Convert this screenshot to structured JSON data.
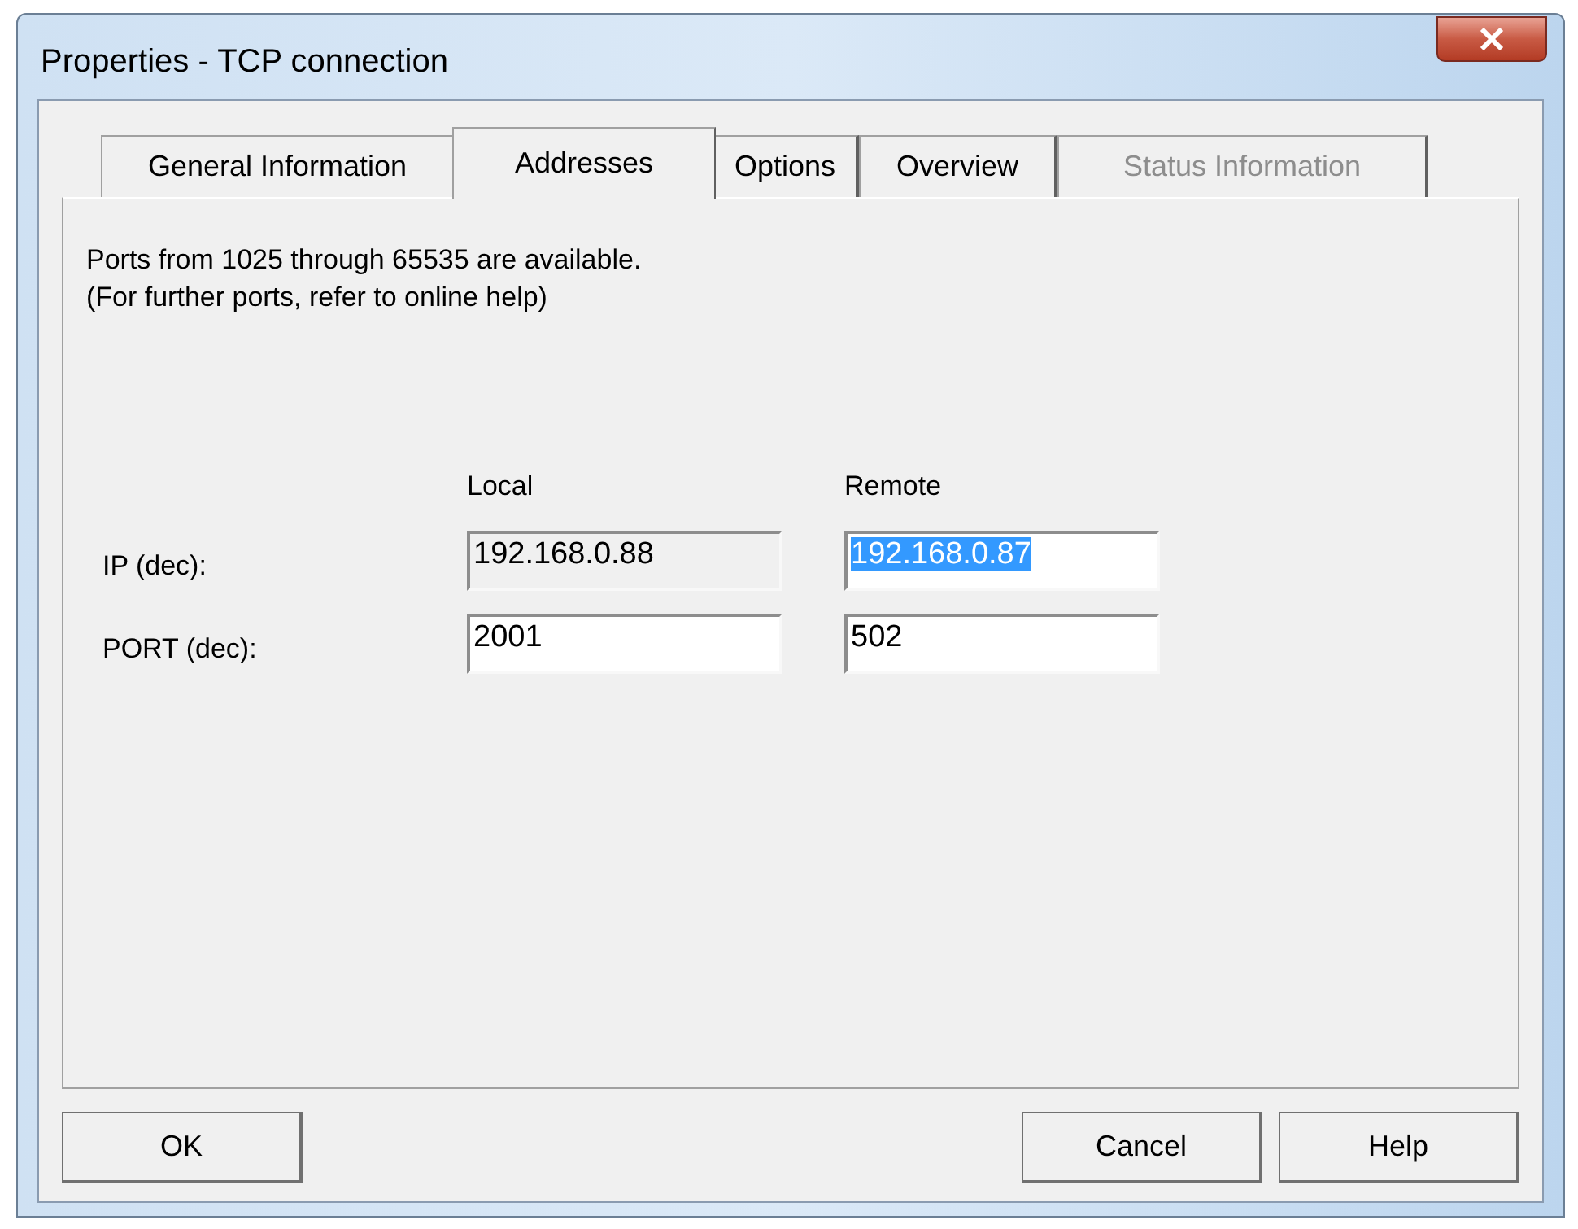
{
  "window": {
    "title": "Properties - TCP connection"
  },
  "tabs": [
    {
      "label": "General Information",
      "selected": false,
      "disabled": false
    },
    {
      "label": "Addresses",
      "selected": true,
      "disabled": false
    },
    {
      "label": "Options",
      "selected": false,
      "disabled": false
    },
    {
      "label": "Overview",
      "selected": false,
      "disabled": false
    },
    {
      "label": "Status Information",
      "selected": false,
      "disabled": true
    }
  ],
  "info_lines": [
    "Ports from 1025 through 65535 are available.",
    "(For further ports, refer to online help)"
  ],
  "columns": [
    "Local",
    "Remote"
  ],
  "rows": [
    {
      "label": "IP (dec):",
      "local": {
        "value": "192.168.0.88",
        "read_only": true,
        "selected": false
      },
      "remote": {
        "value": "192.168.0.87",
        "read_only": false,
        "selected": true
      }
    },
    {
      "label": "PORT (dec):",
      "local": {
        "value": "2001",
        "read_only": false,
        "selected": false
      },
      "remote": {
        "value": "502",
        "read_only": false,
        "selected": false
      }
    }
  ],
  "buttons": {
    "left": [
      "OK"
    ],
    "right": [
      "Cancel",
      "Help"
    ]
  }
}
